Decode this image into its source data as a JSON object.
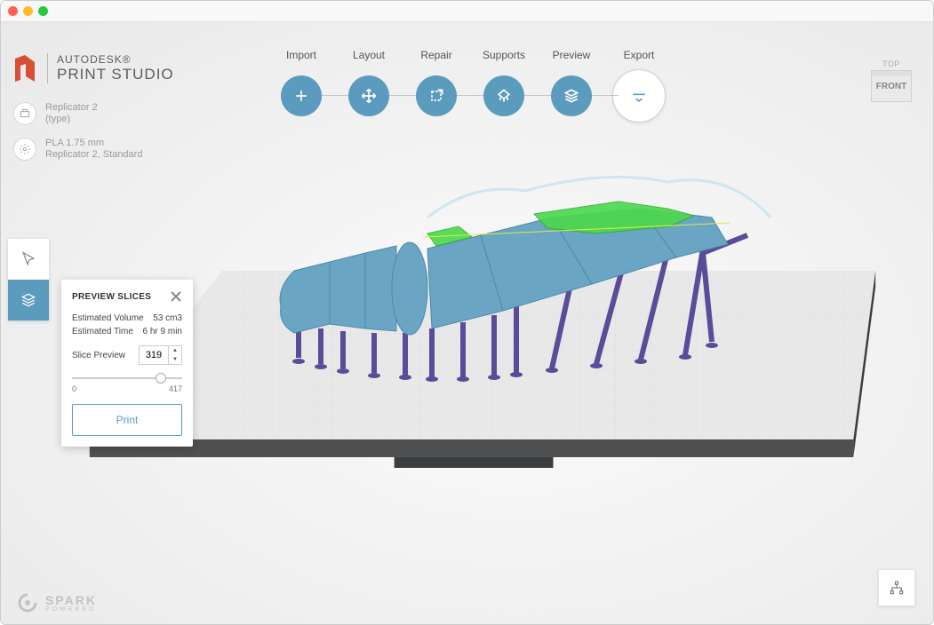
{
  "brand": {
    "line1": "AUTODESK®",
    "line2": "PRINT STUDIO"
  },
  "printer": {
    "name": "Replicator 2",
    "type": "(type)",
    "material": "PLA 1.75 mm",
    "profile": "Replicator 2, Standard"
  },
  "steps": [
    {
      "label": "Import",
      "state": "done",
      "icon": "plus"
    },
    {
      "label": "Layout",
      "state": "done",
      "icon": "move"
    },
    {
      "label": "Repair",
      "state": "done",
      "icon": "repair"
    },
    {
      "label": "Supports",
      "state": "done",
      "icon": "supports"
    },
    {
      "label": "Preview",
      "state": "done",
      "icon": "layers"
    },
    {
      "label": "Export",
      "state": "active",
      "icon": "export"
    }
  ],
  "viewcube": {
    "top": "TOP",
    "front": "FRONT"
  },
  "tools": {
    "select_active": false,
    "layers_active": true
  },
  "panel": {
    "title": "PREVIEW SLICES",
    "est_vol_label": "Estimated Volume",
    "est_vol_value": "53 cm3",
    "est_time_label": "Estimated Time",
    "est_time_value": "6 hr 9 min",
    "slice_label": "Slice Preview",
    "slice_value": "319",
    "slider_min": "0",
    "slider_max": "417",
    "slider_pos_pct": 76,
    "print_label": "Print"
  },
  "footer": {
    "line1": "SPARK",
    "line2": "POWERED"
  },
  "colors": {
    "accent": "#5b9bbd",
    "support": "#5b4b99",
    "slice_highlight": "#4bd94b"
  }
}
